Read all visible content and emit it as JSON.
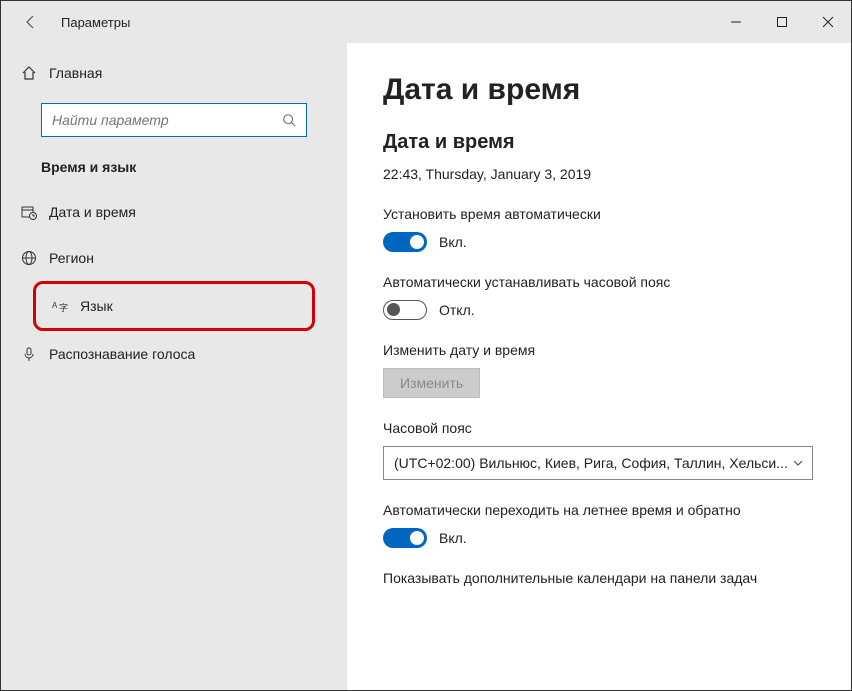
{
  "titlebar": {
    "title": "Параметры"
  },
  "sidebar": {
    "home_label": "Главная",
    "search_placeholder": "Найти параметр",
    "category_title": "Время и язык",
    "items": [
      {
        "label": "Дата и время"
      },
      {
        "label": "Регион"
      },
      {
        "label": "Язык"
      },
      {
        "label": "Распознавание голоса"
      }
    ]
  },
  "content": {
    "page_title": "Дата и время",
    "section_title": "Дата и время",
    "current_datetime": "22:43, Thursday, January 3, 2019",
    "auto_time": {
      "label": "Установить время автоматически",
      "state_text": "Вкл.",
      "on": true
    },
    "auto_tz": {
      "label": "Автоматически устанавливать часовой пояс",
      "state_text": "Откл.",
      "on": false
    },
    "change_dt": {
      "label": "Изменить дату и время",
      "button": "Изменить"
    },
    "timezone": {
      "label": "Часовой пояс",
      "selected": "(UTC+02:00) Вильнюс, Киев, Рига, София, Таллин, Хельси..."
    },
    "dst": {
      "label": "Автоматически переходить на летнее время и обратно",
      "state_text": "Вкл.",
      "on": true
    },
    "extra_calendars": {
      "label": "Показывать дополнительные календари на панели задач"
    }
  }
}
